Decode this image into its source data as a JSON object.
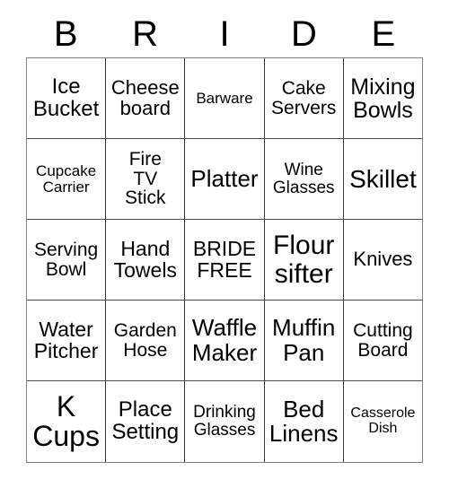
{
  "card": {
    "title_letters": [
      "B",
      "R",
      "I",
      "D",
      "E"
    ],
    "columns": 5,
    "rows": 5,
    "background_color": "#ffffff",
    "text_color": "#000000",
    "border_color": "#808080",
    "grid_line_color": "#333333",
    "free_space": "BRIDE\nFREE",
    "cells": [
      [
        {
          "text": "Ice\nBucket",
          "size": "fs-24"
        },
        {
          "text": "Cheese\nboard",
          "size": "fs-22"
        },
        {
          "text": "Barware",
          "size": "fs-17"
        },
        {
          "text": "Cake\nServers",
          "size": "fs-21"
        },
        {
          "text": "Mixing\nBowls",
          "size": "fs-25"
        }
      ],
      [
        {
          "text": "Cupcake\nCarrier",
          "size": "fs-17"
        },
        {
          "text": "Fire\nTV\nStick",
          "size": "fs-21"
        },
        {
          "text": "Platter",
          "size": "fs-26"
        },
        {
          "text": "Wine\nGlasses",
          "size": "fs-19"
        },
        {
          "text": "Skillet",
          "size": "fs-28"
        }
      ],
      [
        {
          "text": "Serving\nBowl",
          "size": "fs-21"
        },
        {
          "text": "Hand\nTowels",
          "size": "fs-23"
        },
        {
          "text": "BRIDE\nFREE",
          "size": "fs-23"
        },
        {
          "text": "Flour\nsifter",
          "size": "fs-30"
        },
        {
          "text": "Knives",
          "size": "fs-22"
        }
      ],
      [
        {
          "text": "Water\nPitcher",
          "size": "fs-23"
        },
        {
          "text": "Garden\nHose",
          "size": "fs-21"
        },
        {
          "text": "Waffle\nMaker",
          "size": "fs-26"
        },
        {
          "text": "Muffin\nPan",
          "size": "fs-26"
        },
        {
          "text": "Cutting\nBoard",
          "size": "fs-21"
        }
      ],
      [
        {
          "text": "K\nCups",
          "size": "fs-32"
        },
        {
          "text": "Place\nSetting",
          "size": "fs-24"
        },
        {
          "text": "Drinking\nGlasses",
          "size": "fs-19"
        },
        {
          "text": "Bed\nLinens",
          "size": "fs-26"
        },
        {
          "text": "Casserole\nDish",
          "size": "fs-16"
        }
      ]
    ]
  }
}
